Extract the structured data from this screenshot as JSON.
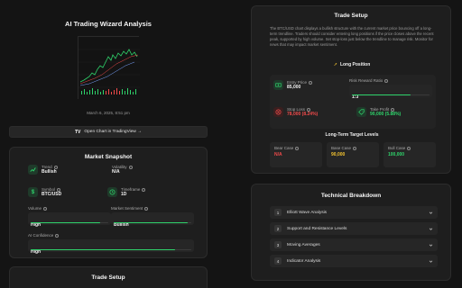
{
  "left": {
    "title": "AI Trading Wizard Analysis",
    "timestamp": "March 6, 2025, 8:51 pm",
    "open_chart_label": "Open Chart in TradingView →",
    "market_snapshot": {
      "title": "Market Snapshot",
      "trend_label": "Trend",
      "trend_value": "Bullish",
      "volatility_label": "Volatility",
      "volatility_value": "N/A",
      "symbol_label": "Symbol",
      "symbol_value": "BTC/USD",
      "timeframe_label": "Timeframe",
      "timeframe_value": "1D",
      "volume_label": "Volume",
      "volume_value": "High",
      "volume_level": 0.9,
      "sentiment_label": "Market Sentiment",
      "sentiment_value": "Bullish",
      "sentiment_level": 0.95,
      "confidence_label": "AI Confidence",
      "confidence_value": "High",
      "confidence_level": 0.9
    },
    "trade_setup_peek_title": "Trade Setup"
  },
  "right": {
    "trade_setup": {
      "title": "Trade Setup",
      "description": "The BTC/USD chart displays a bullish structure with the current market price bouncing off a long-term trendline. Traders should consider entering long positions if the price closes above the recent peak, supported by high volume. Set stop-loss just below the trendline to manage risk. Monitor for news that may impact market sentiment.",
      "position_label": "Long Position",
      "entry_label": "Entry Price",
      "entry_value": "85,000",
      "rr_label": "Risk Reward Ratio",
      "rr_value": "1:3",
      "rr_level": 0.75,
      "stop_label": "Stop Loss",
      "stop_value": "78,000 (8.24%)",
      "tp_label": "Take Profit",
      "tp_value": "90,000 (5.88%)",
      "targets_title": "Long-Term Target Levels",
      "bear_label": "Bear Case",
      "bear_value": "N/A",
      "base_label": "Base Case",
      "base_value": "90,000",
      "bull_label": "Bull Case",
      "bull_value": "100,000"
    },
    "breakdown": {
      "title": "Technical Breakdown",
      "items": [
        {
          "num": "1",
          "label": "Elliott Wave Analysis"
        },
        {
          "num": "2",
          "label": "Support and Resistance Levels"
        },
        {
          "num": "3",
          "label": "Moving Averages"
        },
        {
          "num": "4",
          "label": "Indicator Analysis"
        }
      ]
    }
  },
  "colors": {
    "accent": "#2fd36b",
    "danger": "#f04a4a",
    "warning": "#f2c230",
    "background": "#141414",
    "card": "#1e1e1e"
  }
}
